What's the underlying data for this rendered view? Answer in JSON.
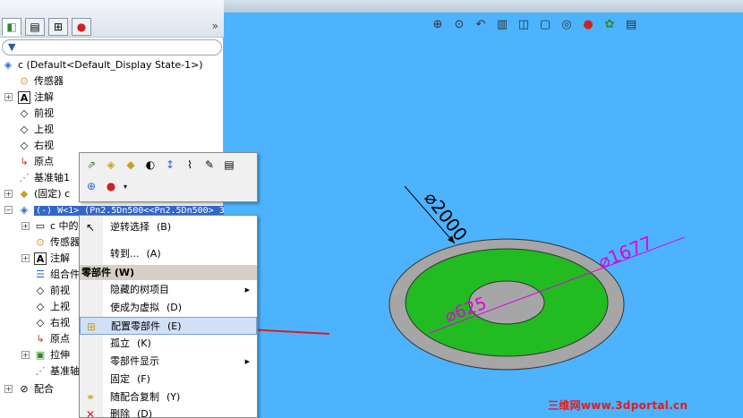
{
  "tree": {
    "top_label": "c  (Default<Default_Display State-1>)",
    "items": [
      {
        "label": "传感器"
      },
      {
        "label": "注解"
      },
      {
        "label": "前视"
      },
      {
        "label": "上视"
      },
      {
        "label": "右视"
      },
      {
        "label": "原点"
      },
      {
        "label": "基准轴1"
      },
      {
        "label": "(固定) c"
      },
      {
        "label": "(-) W<1> (Pn2.5Dn500<<Pn2.5Dn500>_3"
      },
      {
        "label": "c 中的"
      },
      {
        "label": "传感器"
      },
      {
        "label": "注解"
      },
      {
        "label": "组合件"
      },
      {
        "label": "前视"
      },
      {
        "label": "上视"
      },
      {
        "label": "右视"
      },
      {
        "label": "原点"
      },
      {
        "label": "拉伸"
      },
      {
        "label": "基准轴"
      },
      {
        "label": "配合"
      }
    ]
  },
  "menu": {
    "items": [
      {
        "label": "逆转选择",
        "shortcut": "(B)"
      },
      {
        "label": "转到...",
        "shortcut": "(A)"
      },
      {
        "label": "隐藏的树项目",
        "shortcut": ""
      },
      {
        "label": "使成为虚拟",
        "shortcut": "(D)"
      },
      {
        "label": "配置零部件",
        "shortcut": "(E)"
      },
      {
        "label": "孤立",
        "shortcut": "(K)"
      },
      {
        "label": "零部件显示",
        "shortcut": ""
      },
      {
        "label": "固定",
        "shortcut": "(F)"
      },
      {
        "label": "随配合复制",
        "shortcut": "(Y)"
      },
      {
        "label": "删除",
        "shortcut": "(D)"
      }
    ],
    "section_header": "零部件 (W)"
  },
  "drawing": {
    "dim_outer": "2000",
    "dim_middle": "1677",
    "dim_inner": "625",
    "phi": "⌀"
  },
  "watermark": "三维网www.3dportal.cn",
  "colors": {
    "viewport_bg": "#4db3ff",
    "ring_outer": "#a0a0a0",
    "ring_green": "#22bb22",
    "dimension": "#e000e0",
    "arrow": "#e21a1a"
  }
}
